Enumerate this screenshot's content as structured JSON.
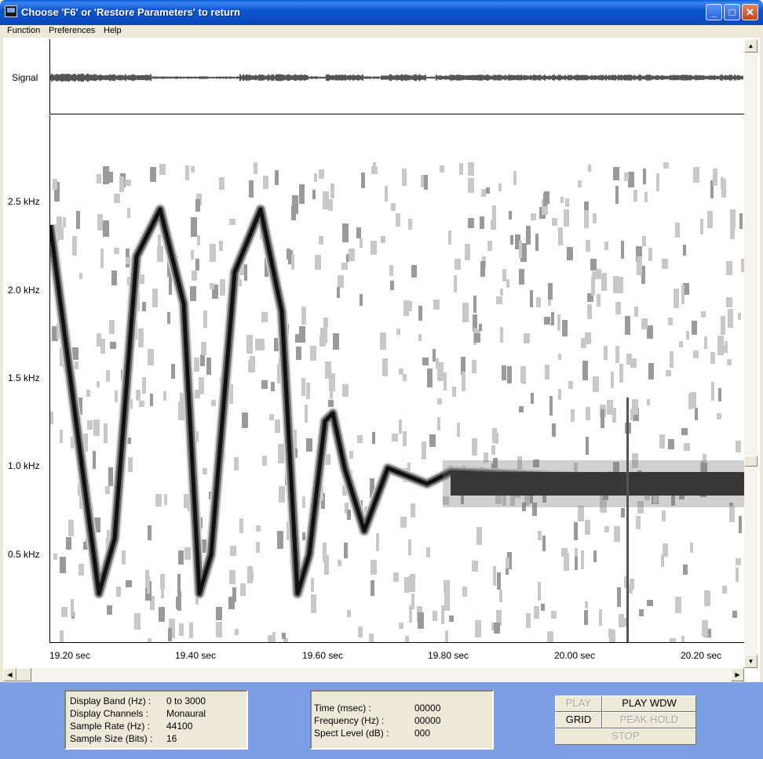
{
  "window": {
    "title": "Choose 'F6' or 'Restore Parameters' to return",
    "minimize_glyph": "_",
    "maximize_glyph": "□",
    "close_glyph": "✕"
  },
  "menu": [
    "Function",
    "Preferences",
    "Help"
  ],
  "signal": {
    "label": "Signal"
  },
  "spectrogram": {
    "y_ticks": [
      "2.5 kHz",
      "2.0 kHz",
      "1.5 kHz",
      "1.0 kHz",
      "0.5 kHz"
    ],
    "x_ticks": [
      "19.20 sec",
      "19.40 sec",
      "19.60 sec",
      "19.80 sec",
      "20.00 sec",
      "20.20 sec"
    ]
  },
  "scrollbar": {
    "up": "▲",
    "down": "▼",
    "left": "◀",
    "right": "▶"
  },
  "display_info": [
    {
      "label": "Display Band (Hz) :",
      "value": "0 to 3000"
    },
    {
      "label": "Display Channels :",
      "value": "Monaural"
    },
    {
      "label": "Sample Rate (Hz) :",
      "value": "44100"
    },
    {
      "label": "Sample Size (Bits) :",
      "value": "16"
    }
  ],
  "cursor_info": [
    {
      "label": "Time (msec) :",
      "value": "00000"
    },
    {
      "label": "Frequency (Hz) :",
      "value": "00000"
    },
    {
      "label": "Spect Level (dB) :",
      "value": "000"
    }
  ],
  "buttons": {
    "play": "PLAY",
    "play_wdw": "PLAY WDW",
    "grid": "GRID",
    "peak_hold": "PEAK HOLD",
    "stop": "STOP"
  }
}
